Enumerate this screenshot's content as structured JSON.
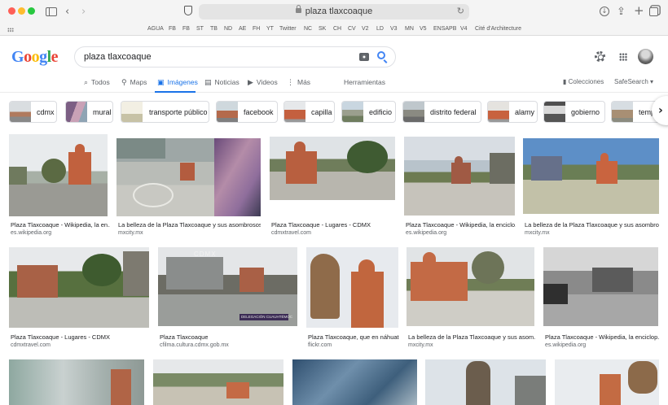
{
  "browser": {
    "url": "plaza tlaxcoaque",
    "favorites": [
      "AGUA",
      "FB",
      "FB",
      "ST",
      "TB",
      "ND",
      "AE",
      "FH",
      "YT",
      "Twitter",
      "NC",
      "SK",
      "CH",
      "CV",
      "V2",
      "LD",
      "V3",
      "MN",
      "V5",
      "ENSAPB",
      "V4",
      "Cité d'Architecture"
    ]
  },
  "search": {
    "query": "plaza tlaxcoaque"
  },
  "tabs": [
    {
      "label": "Todos",
      "icon": "search-icon"
    },
    {
      "label": "Maps",
      "icon": "map-pin-icon"
    },
    {
      "label": "Imágenes",
      "icon": "image-icon"
    },
    {
      "label": "Noticias",
      "icon": "news-icon"
    },
    {
      "label": "Videos",
      "icon": "video-icon"
    },
    {
      "label": "Más",
      "icon": "more-vertical-icon"
    },
    {
      "label": "Herramientas",
      "icon": ""
    }
  ],
  "tools": {
    "colecciones": "Colecciones",
    "safesearch": "SafeSearch ▾"
  },
  "chips": [
    "cdmx",
    "mural",
    "transporte público",
    "facebook",
    "capilla",
    "edificio",
    "distrito federal",
    "alamy",
    "gobierno",
    "temp"
  ],
  "results": [
    {
      "caption": "Plaza Tlaxcoaque - Wikipedia, la en...",
      "source": "es.wikipedia.org"
    },
    {
      "caption": "La belleza de la Plaza Tlaxcoaque y sus asombrosos ...",
      "source": "mxcity.mx"
    },
    {
      "caption": "Plaza Tlaxcoaque - Lugares - CDMX",
      "source": "cdmxtravel.com"
    },
    {
      "caption": "Plaza Tlaxcoaque - Wikipedia, la enciclo...",
      "source": "es.wikipedia.org"
    },
    {
      "caption": "La belleza de la Plaza Tlaxcoaque y sus asombro...",
      "source": "mxcity.mx"
    },
    {
      "caption": "Plaza Tlaxcoaque - Lugares - CDMX",
      "source": "cdmxtravel.com"
    },
    {
      "caption": "Plaza Tlaxcoaque",
      "source": "cfilma.cultura.cdmx.gob.mx"
    },
    {
      "caption": "Plaza Tlaxcoaque, que en náhuat...",
      "source": "flickr.com"
    },
    {
      "caption": "La belleza de la Plaza Tlaxcoaque y sus asom...",
      "source": "mxcity.mx"
    },
    {
      "caption": "Plaza Tlaxcoaque - Wikipedia, la enciclop...",
      "source": "es.wikipedia.org"
    }
  ],
  "image_text": {
    "cdmx_watermark": "CDMX",
    "banner": "DELEGACIÓN CUAUHTÉMOC"
  }
}
